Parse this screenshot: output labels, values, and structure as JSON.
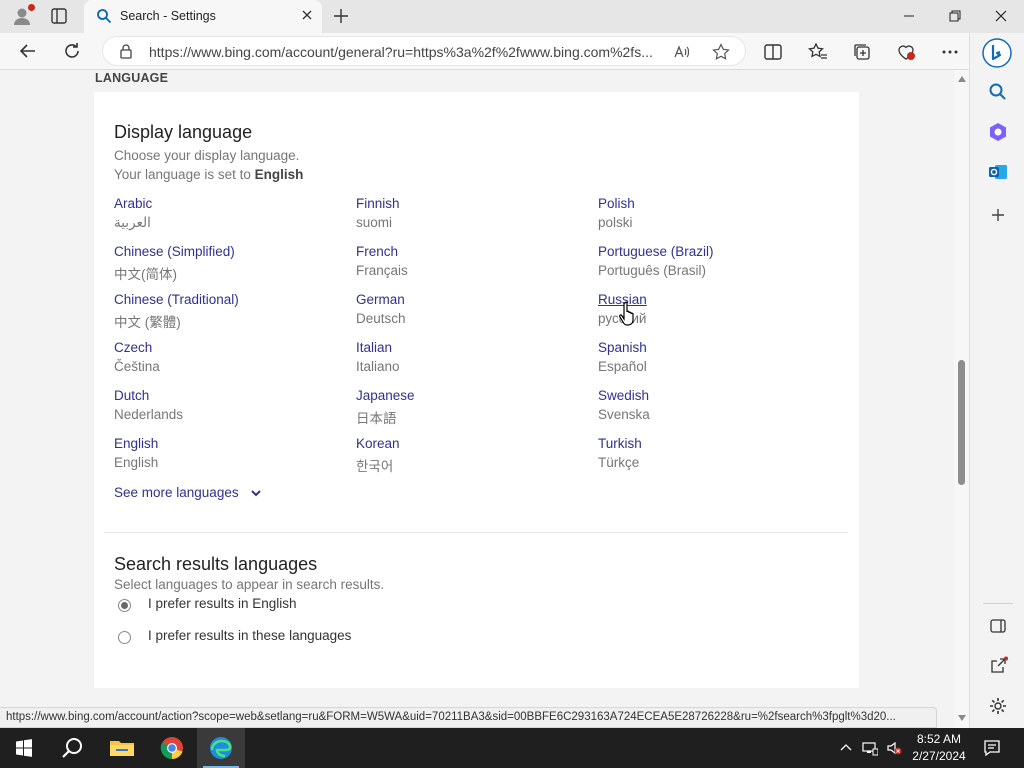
{
  "browser": {
    "tab_title": "Search - Settings",
    "url": "https://www.bing.com/account/general?ru=https%3a%2f%2fwww.bing.com%2fs..."
  },
  "page": {
    "section_heading": "LANGUAGE",
    "display_language": {
      "title": "Display language",
      "subtitle": "Choose your display language.",
      "current_prefix": "Your language is set to",
      "current_value": "English",
      "columns": [
        [
          {
            "name": "Arabic",
            "native": "العربية"
          },
          {
            "name": "Chinese (Simplified)",
            "native": "中文(简体)"
          },
          {
            "name": "Chinese (Traditional)",
            "native": "中文 (繁體)"
          },
          {
            "name": "Czech",
            "native": "Čeština"
          },
          {
            "name": "Dutch",
            "native": "Nederlands"
          },
          {
            "name": "English",
            "native": "English"
          }
        ],
        [
          {
            "name": "Finnish",
            "native": "suomi"
          },
          {
            "name": "French",
            "native": "Français"
          },
          {
            "name": "German",
            "native": "Deutsch"
          },
          {
            "name": "Italian",
            "native": "Italiano"
          },
          {
            "name": "Japanese",
            "native": "日本語"
          },
          {
            "name": "Korean",
            "native": "한국어"
          }
        ],
        [
          {
            "name": "Polish",
            "native": "polski"
          },
          {
            "name": "Portuguese (Brazil)",
            "native": "Português (Brasil)"
          },
          {
            "name": "Russian",
            "native": "русский"
          },
          {
            "name": "Spanish",
            "native": "Español"
          },
          {
            "name": "Swedish",
            "native": "Svenska"
          },
          {
            "name": "Turkish",
            "native": "Türkçe"
          }
        ]
      ],
      "see_more": "See more languages"
    },
    "search_results_languages": {
      "title": "Search results languages",
      "subtitle": "Select languages to appear in search results.",
      "options": [
        {
          "label": "I prefer results in English",
          "checked": true
        },
        {
          "label": "I prefer results in these languages",
          "checked": false
        }
      ]
    }
  },
  "status_bar": {
    "text": "https://www.bing.com/account/action?scope=web&setlang=ru&FORM=W5WA&uid=70211BA3&sid=00BBFE6C293163A724ECEA5E28726228&ru=%2fsearch%3fpglt%3d20..."
  },
  "taskbar": {
    "time": "8:52 AM",
    "date": "2/27/2024"
  },
  "colors": {
    "link": "#2e3192",
    "muted": "#767676",
    "taskbar": "#1f1f1f"
  }
}
